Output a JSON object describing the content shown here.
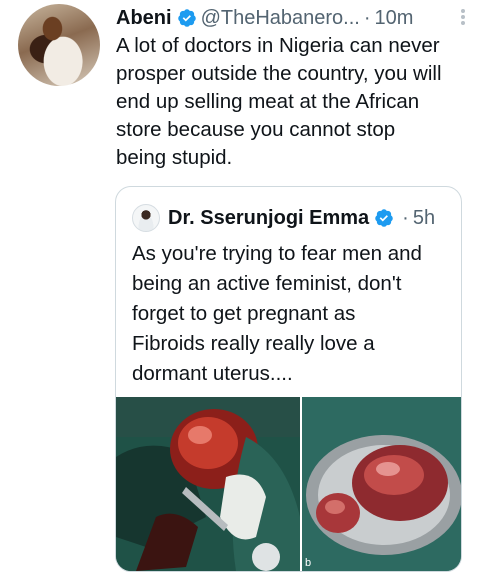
{
  "tweet": {
    "author_name": "Abeni",
    "handle": "@TheHabanero...",
    "separator": "·",
    "time": "10m",
    "text_lines": [
      "A lot of doctors in Nigeria can never",
      "prosper outside the country, you will",
      "end up selling meat at the African",
      "store because you cannot stop",
      "being stupid."
    ]
  },
  "quote": {
    "author_name": "Dr. Sserunjogi Emma",
    "separator": "·",
    "time": "5h",
    "text_lines": [
      "As you're trying to fear men and",
      "being an active feminist, don't",
      "forget to get pregnant as",
      "Fibroids really really love a",
      "dormant uterus...."
    ],
    "media": {
      "image_count": 2,
      "second_image_label": "b"
    }
  },
  "colors": {
    "verified": "#1d9bf0",
    "secondary_text": "#536471",
    "border": "#cfd9de"
  }
}
